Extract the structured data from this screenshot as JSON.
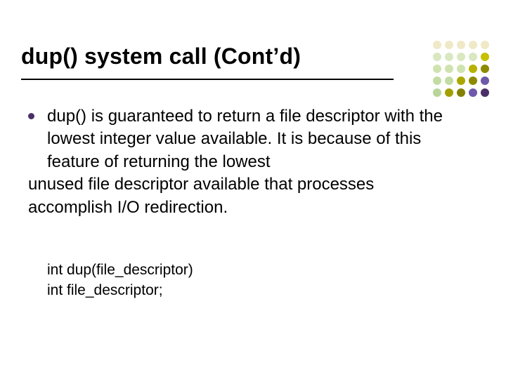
{
  "slide": {
    "title": "dup() system call (Cont’d)",
    "bullet": {
      "line1": "dup() is guaranteed to return a file descriptor with the lowest integer value available.  It is because of this feature of returning the lowest",
      "line2": "unused file descriptor available that processes accomplish I/O redirection."
    },
    "code": {
      "l1": "int dup(file_descriptor)",
      "l2": "int file_descriptor;"
    }
  },
  "decor": {
    "dot_colors": [
      "#efe9c7",
      "#efe9c7",
      "#efe9c7",
      "#efe9c7",
      "#efe9c7",
      "#d9e8c0",
      "#d9e8c0",
      "#d9e8c0",
      "#d9e8c0",
      "#c6c000",
      "#cfe3b0",
      "#cfe3b0",
      "#cfe3b0",
      "#b7b200",
      "#8e8a00",
      "#c3dca4",
      "#c3dca4",
      "#aca700",
      "#8e8a00",
      "#6e5aa8",
      "#b9d598",
      "#a39f00",
      "#848100",
      "#6e5aa8",
      "#4b3068"
    ]
  }
}
